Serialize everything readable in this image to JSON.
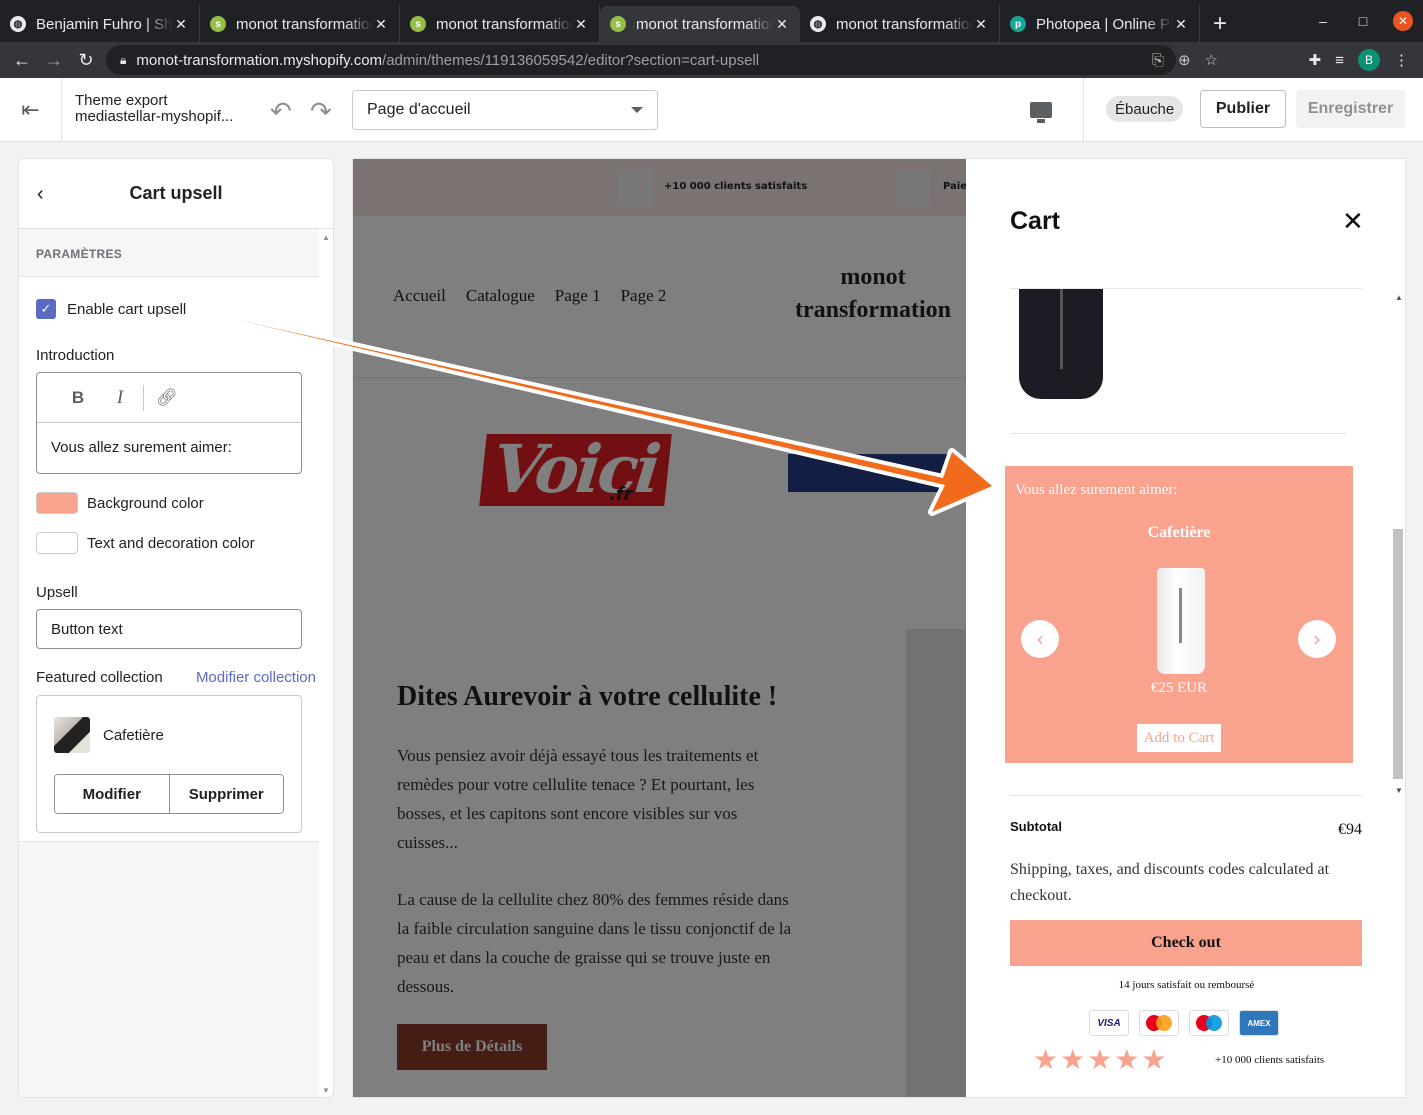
{
  "browser": {
    "tabs": [
      {
        "title": "Benjamin Fuhro | Shopify",
        "icon": "globe-icon",
        "active": false
      },
      {
        "title": "monot transformation",
        "icon": "shopify-icon",
        "active": false
      },
      {
        "title": "monot transformation",
        "icon": "shopify-icon",
        "active": false
      },
      {
        "title": "monot transformation",
        "icon": "shopify-icon",
        "active": true
      },
      {
        "title": "monot transformation",
        "icon": "globe-icon",
        "active": false
      },
      {
        "title": "Photopea | Online Photo Editor",
        "icon": "photopea-icon",
        "active": false
      }
    ],
    "url_host": "monot-transformation.myshopify.com",
    "url_path": "/admin/themes/119136059542/editor?section=cart-upsell",
    "profile_initial": "B"
  },
  "editor": {
    "theme_name_line1": "Theme export",
    "theme_name_line2": "mediastellar-myshopif...",
    "page_select_value": "Page d'accueil",
    "draft_badge": "Ébauche",
    "publish_label": "Publier",
    "save_label": "Enregistrer"
  },
  "sidebar": {
    "title": "Cart upsell",
    "section_label": "PARAMÈTRES",
    "enable_label": "Enable cart upsell",
    "enable_checked": true,
    "intro_label": "Introduction",
    "rte_bold": "B",
    "rte_italic": "I",
    "intro_text": "Vous allez surement aimer:",
    "bg_color_label": "Background color",
    "bg_color": "#f9a28e",
    "text_color_label": "Text and decoration color",
    "text_color": "#ffffff",
    "upsell_label": "Upsell",
    "button_text_value": "Button text",
    "featured_label": "Featured collection",
    "modify_collection_link": "Modifier collection",
    "collection_name": "Cafetière",
    "modify_button": "Modifier",
    "delete_button": "Supprimer"
  },
  "site": {
    "announcement_1": "+10 000 clients satisfaits",
    "announcement_2": "Paie",
    "nav_links": [
      "Accueil",
      "Catalogue",
      "Page 1",
      "Page 2"
    ],
    "logo_line1": "monot",
    "logo_line2": "transformation",
    "press_logo": "Voici",
    "press_logo_suffix": ".fr",
    "heading": "Dites Aurevoir à votre cellulite !",
    "paragraph1": "Vous pensiez avoir déjà essayé tous les traitements et remèdes pour votre cellulite tenace ? Et pourtant, les bosses, et les capitons sont encore visibles sur vos cuisses...",
    "paragraph2": "La cause de la cellulite chez 80% des femmes réside dans la faible circulation sanguine dans le tissu conjonctif de la peau et dans la couche de graisse qui se trouve juste en dessous.",
    "cta": "Plus de Détails"
  },
  "cart": {
    "title": "Cart",
    "upsell_intro": "Vous allez surement aimer:",
    "upsell_product": "Cafetière",
    "upsell_price": "€25 EUR",
    "upsell_button": "Add to Cart",
    "subtotal_label": "Subtotal",
    "subtotal_value": "€94",
    "shipping_note": "Shipping, taxes, and discounts codes calculated at checkout.",
    "checkout_label": "Check out",
    "guarantee": "14 jours satisfait ou remboursé",
    "payments": [
      "VISA",
      "Mastercard",
      "Maestro",
      "AMEX"
    ],
    "rating_stars": 5,
    "stars_text": "★★★★★",
    "satisfied": "+10 000 clients satisfaits",
    "accent_color": "#f9a28e"
  },
  "annotation": {
    "arrow_color": "#f26b1d"
  }
}
